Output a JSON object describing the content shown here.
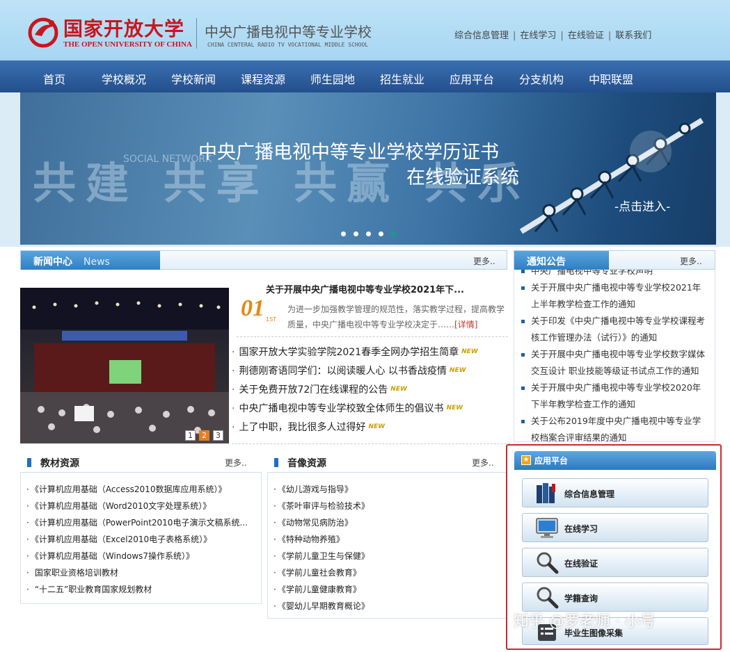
{
  "header": {
    "logo_cn": "国家开放大学",
    "logo_en": "THE OPEN UNIVERSITY OF CHINA",
    "school_cn": "中央广播电视中等专业学校",
    "school_en": "CHINA CENTERAL RADIO TV VOCATIONAL MIDDLE SCHOOL",
    "top_links": [
      "综合信息管理",
      "在线学习",
      "在线验证",
      "联系我们"
    ]
  },
  "nav": [
    "首页",
    "学校概况",
    "学校新闻",
    "课程资源",
    "师生园地",
    "招生就业",
    "应用平台",
    "分支机构",
    "中职联盟"
  ],
  "banner": {
    "watermark": "共建 共享 共赢 共乐",
    "social_text": "SOCIAL NETWORK",
    "title_line1": "中央广播电视中等专业学校学历证书",
    "title_line2": "在线验证系统",
    "cta": "-点击进入-",
    "slide_count": 5
  },
  "news": {
    "title": "新闻中心",
    "title_en": "News",
    "more": "更多..",
    "pagers": [
      "1",
      "2",
      "3"
    ],
    "active_pager": "2",
    "featured": {
      "title": "关于开展中央广播电视中等专业学校2021年下...",
      "date": "01",
      "date_sub": "1ST",
      "desc": "为进一步加强教学管理的规范性，落实教学过程，提高教学质量，中央广播电视中等专业学校决定于……",
      "detail": "[详情]"
    },
    "items": [
      {
        "text": "国家开放大学实验学院2021春季全网办学招生简章",
        "badge": "NEW"
      },
      {
        "text": "荆德刚寄语同学们：以阅读暖人心 以书香战疫情",
        "badge": "NEW"
      },
      {
        "text": "关于免费开放72门在线课程的公告",
        "badge": "NEW"
      },
      {
        "text": "中央广播电视中等专业学校致全体师生的倡议书",
        "badge": "NEW"
      },
      {
        "text": "上了中职，我比很多人过得好",
        "badge": "NEW"
      }
    ]
  },
  "notices": {
    "title": "通知公告",
    "more": "更多..",
    "items": [
      "中央广播电视中等专业学校声明",
      "关于开展中央广播电视中等专业学校2021年上半年教学检查工作的通知",
      "关于印发《中央广播电视中等专业学校课程考核工作管理办法（试行）》的通知",
      "关于开展中央广播电视中等专业学校数字媒体交互设计 职业技能等级证书试点工作的通知",
      "关于开展中央广播电视中等专业学校2020年下半年教学检查工作的通知",
      "关于公布2019年度中央广播电视中等专业学校档案合评审结果的通知"
    ]
  },
  "textbooks": {
    "title": "教材资源",
    "more": "更多..",
    "items": [
      "《计算机应用基础（Access2010数据库应用系统）》",
      "《计算机应用基础（Word2010文字处理系统）》",
      "《计算机应用基础（PowerPoint2010电子演示文稿系统...",
      "《计算机应用基础（Excel2010电子表格系统）》",
      "《计算机应用基础（Windows7操作系统）》",
      "国家职业资格培训教材",
      "“十二五”职业教育国家规划教材"
    ]
  },
  "videos": {
    "title": "音像资源",
    "more": "更多..",
    "items": [
      "《幼儿游戏与指导》",
      "《茶叶审评与检验技术》",
      "《动物常见病防治》",
      "《特种动物养殖》",
      "《学前儿童卫生与保健》",
      "《学前儿童社会教育》",
      "《学前儿童健康教育》",
      "《婴幼儿早期教育概论》"
    ]
  },
  "app_platform": {
    "title": "应用平台",
    "buttons": [
      "综合信息管理",
      "在线学习",
      "在线验证",
      "学籍查询",
      "毕业生图像采集"
    ]
  },
  "watermark": "知乎 @罗老师 · 小号",
  "colors": {
    "brand_red": "#c8161d",
    "nav_blue": "#2a5a9a",
    "accent_orange": "#e8860f",
    "frame_red": "#d4242a"
  }
}
